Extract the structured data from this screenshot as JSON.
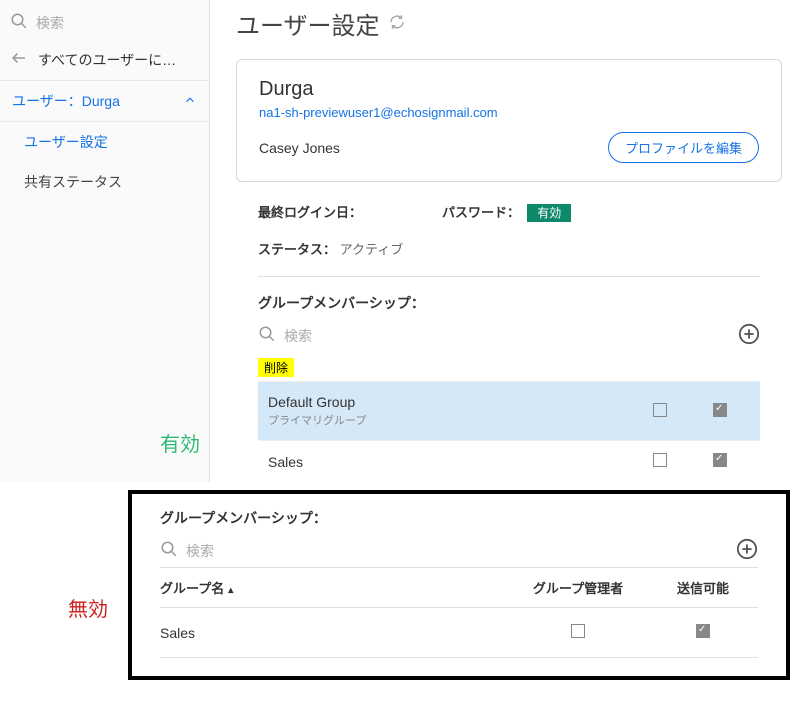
{
  "sidebar": {
    "search_placeholder": "検索",
    "back_label": "すべてのユーザーに…",
    "user_label": "ユーザー：Durga",
    "items": [
      {
        "label": "ユーザー設定"
      },
      {
        "label": "共有ステータス"
      }
    ]
  },
  "header": {
    "title": "ユーザー設定"
  },
  "card": {
    "name": "Durga",
    "email": "na1-sh-previewuser1@echosignmail.com",
    "subname": "Casey Jones",
    "edit_button": "プロファイルを編集"
  },
  "meta": {
    "last_login_label": "最終ログイン日：",
    "last_login_value": "",
    "password_label": "パスワード：",
    "password_badge": "有効",
    "status_label": "ステータス：",
    "status_value": "アクティブ"
  },
  "groups": {
    "title": "グループメンバーシップ：",
    "search_placeholder": "検索",
    "delete_tag": "削除",
    "rows": [
      {
        "name": "Default Group",
        "sub": "プライマリグループ",
        "admin": false,
        "send": true
      },
      {
        "name": "Sales",
        "sub": "",
        "admin": false,
        "send": true
      }
    ]
  },
  "annotations": {
    "valid": "有効",
    "invalid": "無効"
  },
  "overlay": {
    "title": "グループメンバーシップ：",
    "search_placeholder": "検索",
    "col_group": "グループ名",
    "col_admin": "グループ管理者",
    "col_send": "送信可能",
    "rows": [
      {
        "name": "Sales",
        "admin": false,
        "send": true
      }
    ]
  }
}
